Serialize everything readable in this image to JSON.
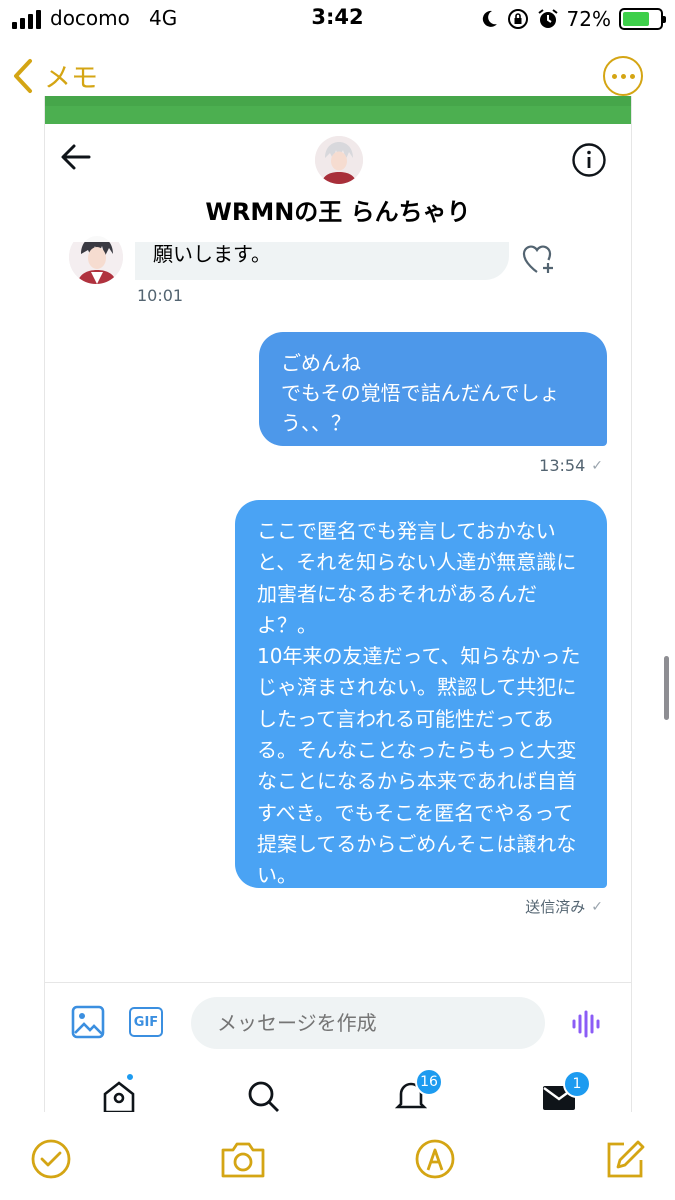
{
  "status": {
    "carrier": "docomo",
    "network": "4G",
    "time": "3:42",
    "battery": "72%",
    "battery_level": 0.72
  },
  "notes_nav": {
    "back_label": "メモ"
  },
  "dm": {
    "name": "WRMNの王 らんちゃり",
    "incoming": {
      "text": "願いします。",
      "time": "10:01"
    },
    "outgoing": [
      {
        "text": "ごめんね\nでもその覚悟で詰んだんでしょう、、？",
        "time": "13:54"
      },
      {
        "text": "ここで匿名でも発言しておかないと、それを知らない人達が無意識に加害者になるおそれがあるんだよ？。\n10年来の友達だって、知らなかったじゃ済まされない。黙認して共犯にしたって言われる可能性だってある。そんなことなったらもっと大変なことになるから本来であれば自首すべき。でもそこを匿名でやるって提案してるからごめんそこは譲れない。",
        "status": "送信済み"
      }
    ],
    "composer": {
      "placeholder": "メッセージを作成",
      "gif_label": "GIF"
    },
    "tabs": {
      "notifications_badge": "16",
      "messages_badge": "1"
    }
  },
  "colors": {
    "notes_accent": "#d4a514",
    "twitter_blue": "#1d9bf0",
    "bubble_blue": "#4aa3f4"
  }
}
